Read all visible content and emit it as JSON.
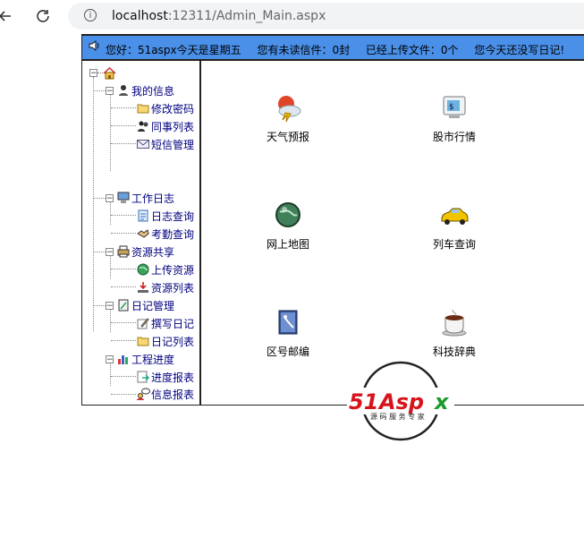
{
  "browser": {
    "url_host": "localhost",
    "url_rest": ":12311/Admin_Main.aspx"
  },
  "topbar": {
    "greeting": "您好：51aspx今天是星期五",
    "unread": "您有未读信件：0封",
    "uploaded": "已经上传文件：0个",
    "diary": "您今天还没写日记!"
  },
  "tree": {
    "groups": [
      {
        "label": "我的信息",
        "icon": "person-icon",
        "items": [
          {
            "label": "修改密码",
            "icon": "folder-icon"
          },
          {
            "label": "同事列表",
            "icon": "people-icon"
          },
          {
            "label": "短信管理",
            "icon": "mail-icon"
          }
        ]
      },
      {
        "label": "工作日志",
        "icon": "computer-icon",
        "items": [
          {
            "label": "日志查询",
            "icon": "document-icon"
          },
          {
            "label": "考勤查询",
            "icon": "handshake-icon"
          }
        ]
      },
      {
        "label": "资源共享",
        "icon": "printer-icon",
        "items": [
          {
            "label": "上传资源",
            "icon": "globe-icon"
          },
          {
            "label": "资源列表",
            "icon": "download-icon"
          }
        ]
      },
      {
        "label": "日记管理",
        "icon": "notebook-icon",
        "items": [
          {
            "label": "撰写日记",
            "icon": "edit-icon"
          },
          {
            "label": "日记列表",
            "icon": "folder-icon"
          }
        ]
      },
      {
        "label": "工程进度",
        "icon": "chart-icon",
        "items": [
          {
            "label": "进度报表",
            "icon": "report-icon"
          },
          {
            "label": "信息报表",
            "icon": "chat-user-icon"
          }
        ]
      }
    ]
  },
  "apps": [
    {
      "label": "天气预报",
      "icon": "weather-icon"
    },
    {
      "label": "股市行情",
      "icon": "stock-monitor-icon"
    },
    {
      "label": "网上地图",
      "icon": "globe-map-icon"
    },
    {
      "label": "列车查询",
      "icon": "car-icon"
    },
    {
      "label": "区号邮编",
      "icon": "phone-book-icon"
    },
    {
      "label": "科技辞典",
      "icon": "coffee-cup-icon"
    }
  ],
  "watermark": {
    "brand_51": "51",
    "brand_aspx": "Aspx",
    "tagline": "源码服务专家"
  },
  "colors": {
    "topbar_bg": "#4a8fe8",
    "tree_text": "#000080",
    "brand_red": "#d6141c",
    "brand_green": "#1a9a2a"
  }
}
